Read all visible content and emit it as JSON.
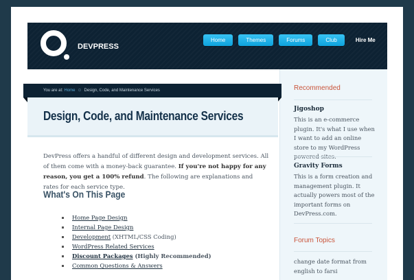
{
  "brand": {
    "name": "DEVPRESS"
  },
  "nav": {
    "items": [
      {
        "label": "Home"
      },
      {
        "label": "Themes"
      },
      {
        "label": "Forums"
      },
      {
        "label": "Club"
      }
    ],
    "hire_label": "Hire Me"
  },
  "breadcrumb": {
    "prefix": "You are at:",
    "home": "Home",
    "separator": "⊙",
    "current": "Design, Code, and Maintenance Services"
  },
  "page": {
    "title": "Design, Code, and Maintenance Services",
    "intro_part1": "DevPress offers a handful of different design and development services. All of them come with a money-back guarantee. ",
    "intro_bold": "If you're not happy for any reason, you get a 100% refund",
    "intro_part2": ". The following are explanations and rates for each service type.",
    "toc_heading": "What's On This Page",
    "toc": [
      {
        "link": "Home Page Design",
        "note": ""
      },
      {
        "link": "Internal Page Design",
        "note": ""
      },
      {
        "link": "Development",
        "note": " (XHTML/CSS Coding)"
      },
      {
        "link": "WordPress Related Services",
        "note": ""
      },
      {
        "link": "Discount Packages",
        "note": " (Highly Recommended)"
      },
      {
        "link": "Common Questions & Answers",
        "note": ""
      }
    ]
  },
  "sidebar": {
    "recommended_heading": "Recommended",
    "items": [
      {
        "title": "Jigoshop",
        "text": "This is an e-commerce plugin. It's what I use when I want to add an online store to my WordPress powered sites."
      },
      {
        "title": "Gravity Forms",
        "text": "This is a form creation and management plugin. It actually powers most of the important forms on DevPress.com."
      }
    ],
    "forum_heading": "Forum Topics",
    "forum_topics": [
      "change date format from english to farsi"
    ]
  },
  "colors": {
    "header_bg": "#0d2233",
    "nav_button": "#1eb2ea",
    "sidebar_heading": "#c9543a",
    "page_title": "#14314a"
  }
}
